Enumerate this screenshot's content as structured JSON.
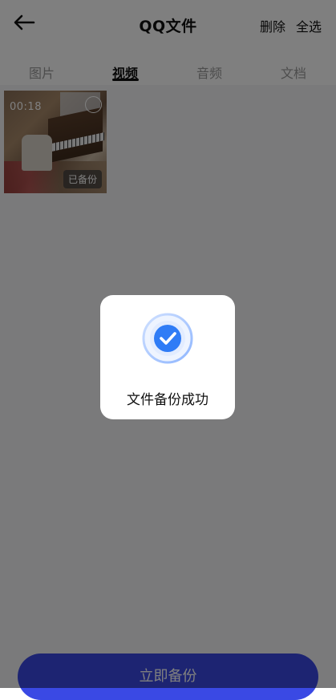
{
  "header": {
    "title": "QQ文件",
    "delete_label": "删除",
    "select_all_label": "全选"
  },
  "tabs": [
    {
      "label": "图片",
      "active": false
    },
    {
      "label": "视频",
      "active": true
    },
    {
      "label": "音频",
      "active": false
    },
    {
      "label": "文档",
      "active": false
    }
  ],
  "files": [
    {
      "duration": "00:18",
      "status": "已备份",
      "selected": false
    }
  ],
  "backup_button": {
    "label": "立即备份"
  },
  "toast": {
    "message": "文件备份成功",
    "icon": "check-circle-icon"
  },
  "colors": {
    "accent": "#3a49e4",
    "check_blue": "#2f7cf6"
  }
}
